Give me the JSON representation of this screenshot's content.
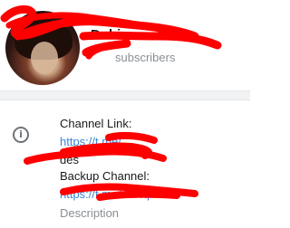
{
  "header": {
    "channel_name": "Dubi",
    "subscribers_label": "subscribers"
  },
  "info": {
    "channel_link_label": "Channel Link:",
    "channel_link_value": "https://t.me/",
    "middle_text": "des",
    "backup_channel_label": "Backup Channel:",
    "backup_link_value": "https://t.me/...INqrx",
    "description_label": "Description"
  },
  "colors": {
    "redaction": "#ff0000",
    "link": "#3a85d8",
    "muted": "#8a8f94"
  },
  "icons": {
    "info": "info-circle-icon"
  }
}
